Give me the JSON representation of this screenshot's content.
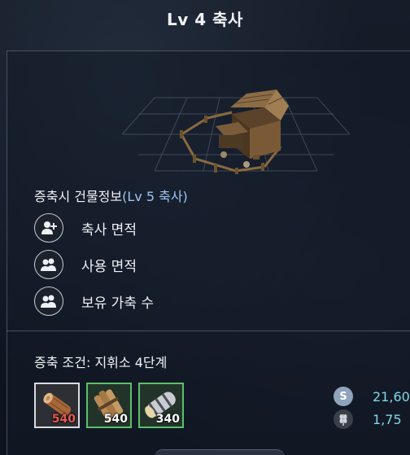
{
  "header": {
    "title": "Lv 4 축사"
  },
  "upgrade_info": {
    "title_prefix": "증축시 건물정보",
    "title_level": "(Lv 5 축사)",
    "stats": [
      {
        "icon": "add-person-icon",
        "label": "축사 면적"
      },
      {
        "icon": "people-icon",
        "label": "사용 면적"
      },
      {
        "icon": "people-icon",
        "label": "보유 가축 수"
      }
    ]
  },
  "requirements": {
    "condition": "증축 조건: 지휘소 4단계",
    "materials": [
      {
        "icon": "log-icon",
        "quantity": "540",
        "state": "selected-insufficient"
      },
      {
        "icon": "wood-bundle-icon",
        "quantity": "540",
        "state": "sufficient"
      },
      {
        "icon": "stone-bundle-icon",
        "quantity": "340",
        "state": "sufficient"
      }
    ],
    "costs": [
      {
        "icon": "silver-coin-icon",
        "value": "21,60"
      },
      {
        "icon": "wheat-icon",
        "value": "1,75"
      }
    ]
  },
  "colors": {
    "level_highlight": "#9fc3f0",
    "insufficient": "#e25a4f",
    "sufficient_border": "#5bbf6a",
    "resource_value": "#7fd6e6"
  }
}
